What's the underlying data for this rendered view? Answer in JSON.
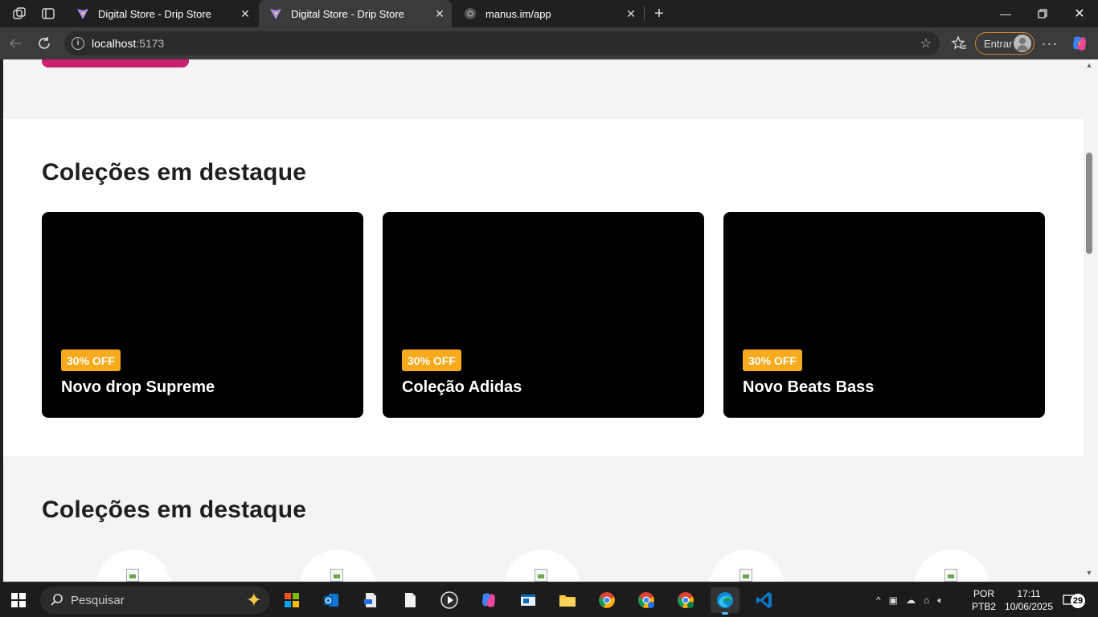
{
  "browser": {
    "tabs": [
      {
        "title": "Digital Store - Drip Store",
        "active": false
      },
      {
        "title": "Digital Store - Drip Store",
        "active": true
      },
      {
        "title": "manus.im/app",
        "active": false
      }
    ],
    "address": {
      "host": "localhost",
      "port": ":5173"
    },
    "signin_label": "Entrar"
  },
  "page": {
    "featured_title": "Coleções em destaque",
    "cards": [
      {
        "badge": "30% OFF",
        "title": "Novo drop Supreme"
      },
      {
        "badge": "30% OFF",
        "title": "Coleção Adidas"
      },
      {
        "badge": "30% OFF",
        "title": "Novo Beats Bass"
      }
    ],
    "second_title": "Coleções em destaque",
    "brand_color": "#c92071",
    "badge_color": "#f6aa1c"
  },
  "taskbar": {
    "search_placeholder": "Pesquisar",
    "lang_line1": "POR",
    "lang_line2": "PTB2",
    "time": "17:11",
    "date": "10/06/2025",
    "notification_count": "29"
  }
}
